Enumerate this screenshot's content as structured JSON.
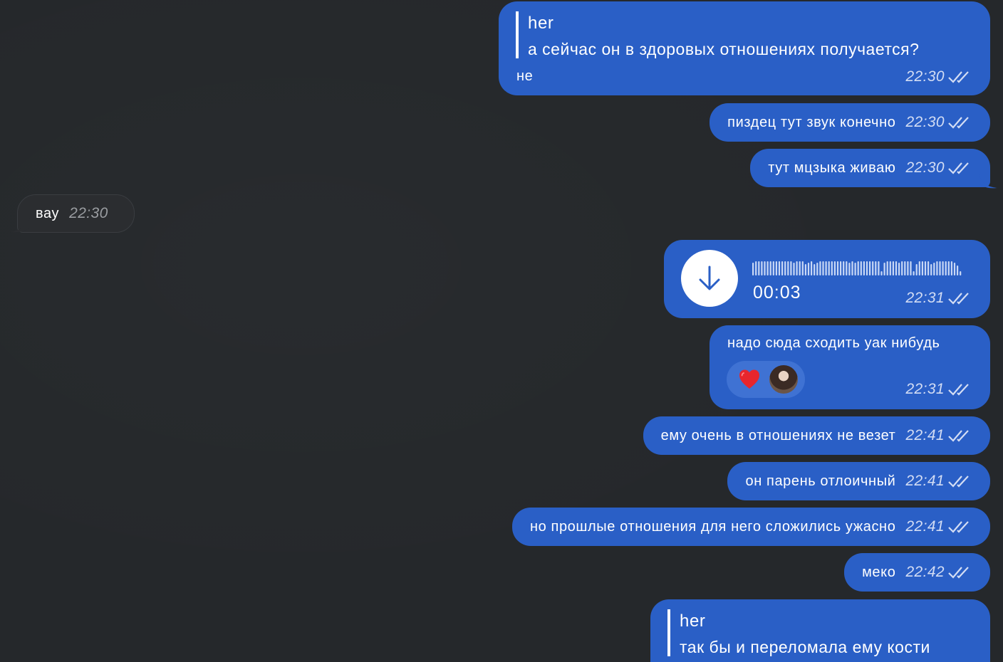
{
  "messages": [
    {
      "id": "m1",
      "dir": "out",
      "reply_author": "her",
      "reply_text": "а сейчас он в здоровых отношениях получается?",
      "text": "не",
      "time": "22:30"
    },
    {
      "id": "m2",
      "dir": "out",
      "text": "пиздец тут звук конечно",
      "time": "22:30"
    },
    {
      "id": "m3",
      "dir": "out",
      "text": "тут мцзыка живаю",
      "time": "22:30"
    },
    {
      "id": "m4",
      "dir": "in",
      "text": "вау",
      "time": "22:30"
    },
    {
      "id": "m5",
      "dir": "out",
      "voice_duration": "00:03",
      "time": "22:31"
    },
    {
      "id": "m6",
      "dir": "out",
      "text": "надо сюда сходить уак нибудь",
      "time": "22:31",
      "reaction": "heart"
    },
    {
      "id": "m7",
      "dir": "out",
      "text": "ему очень в отношениях не везет",
      "time": "22:41"
    },
    {
      "id": "m8",
      "dir": "out",
      "text": "он парень отлоичный",
      "time": "22:41"
    },
    {
      "id": "m9",
      "dir": "out",
      "text": "но прошлые отношения для него сложились ужасно",
      "time": "22:41"
    },
    {
      "id": "m10",
      "dir": "out",
      "text": "меко",
      "time": "22:42"
    },
    {
      "id": "m11",
      "dir": "out",
      "reply_author": "her",
      "reply_text": "так бы и переломала ему кости"
    }
  ],
  "colors": {
    "background": "#25282b",
    "outgoing_bubble": "#2a5fc6",
    "incoming_bubble": "#2b2d30",
    "reaction_pill": "#3f72d3"
  },
  "icons": {
    "read_status": "double-check-icon",
    "voice_download": "download-arrow-icon",
    "reaction": "heart-icon"
  }
}
